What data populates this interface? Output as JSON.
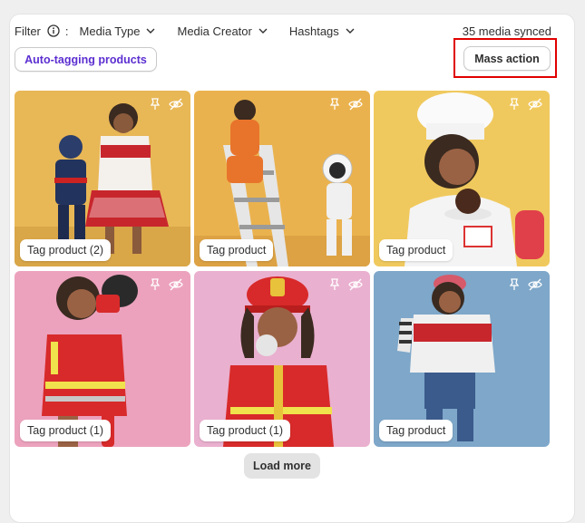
{
  "filter": {
    "label": "Filter",
    "colon": ":",
    "dropdowns": [
      {
        "label": "Media Type"
      },
      {
        "label": "Media Creator"
      },
      {
        "label": "Hashtags"
      }
    ],
    "synced_text": "35 media synced"
  },
  "actions": {
    "auto_tagging_label": "Auto-tagging products",
    "mass_action_label": "Mass action"
  },
  "colors": {
    "accent": "#5c2fd1",
    "highlight": "#e00000",
    "tile_backgrounds": [
      "#e8b756",
      "#eab24e",
      "#f0c95e",
      "#eca2bd",
      "#eab0cf",
      "#7ea7c9"
    ]
  },
  "media": [
    {
      "tag_label": "Tag product (2)",
      "icons": [
        "pin-icon",
        "hidden-eye-icon"
      ]
    },
    {
      "tag_label": "Tag product",
      "icons": [
        "pin-icon",
        "hidden-eye-icon"
      ]
    },
    {
      "tag_label": "Tag product",
      "icons": [
        "pin-icon",
        "hidden-eye-icon"
      ]
    },
    {
      "tag_label": "Tag product (1)",
      "icons": [
        "pin-icon",
        "hidden-eye-icon"
      ]
    },
    {
      "tag_label": "Tag product (1)",
      "icons": [
        "pin-icon",
        "hidden-eye-icon"
      ]
    },
    {
      "tag_label": "Tag product",
      "icons": [
        "pin-icon",
        "hidden-eye-icon"
      ]
    }
  ],
  "load_more_label": "Load more"
}
